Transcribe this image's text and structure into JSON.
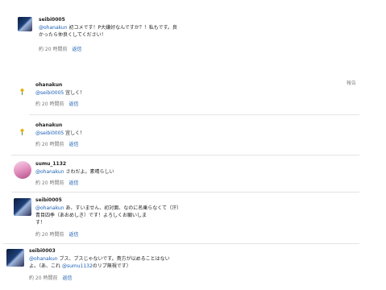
{
  "comments": [
    {
      "username": "seibi0005",
      "mention": "@ohanakun",
      "text_line1": "初コメです！P大嫌好なんですか？！私もです。良",
      "text_line2": "かったら仲良くしてください！",
      "time": "約 20 時間前",
      "reply_label": "返信"
    },
    {
      "username": "ohanakun",
      "mention": "@seibi0005",
      "text_line1": "宜しく！",
      "time": "約 20 時間前",
      "reply_label": "返信"
    },
    {
      "username": "ohanakun",
      "mention": "@seibi0005",
      "text_line1": "宜しく！",
      "time": "約 20 時間前",
      "reply_label": "返信"
    },
    {
      "username": "sumu_1132",
      "mention": "@ohanakun",
      "text_line1": "さわだよ。素晴らしい",
      "time": "約 20 時間前",
      "reply_label": "返信"
    },
    {
      "username": "seibi0005",
      "mention": "@ohanakun",
      "text_line1": "あ、すいません、初対面、なのに名乗らなくて（汗）",
      "text_line2": "青目四季（あおめしき）です！よろしくお願いしま",
      "text_line3": "す！",
      "time": "約 20 時間前",
      "reply_label": "返信"
    },
    {
      "username": "seibi0003",
      "mention": "@ohanakun",
      "text_line1": "ブス、ブスじゃないです。貴方が以めることはない",
      "text_line2": "よ。（あ、これ",
      "mention2": "@sumu1132",
      "text_line2b": "のリプ無視です）",
      "time": "約 20 時間前",
      "reply_label": "返信"
    }
  ],
  "side_label": "報告"
}
